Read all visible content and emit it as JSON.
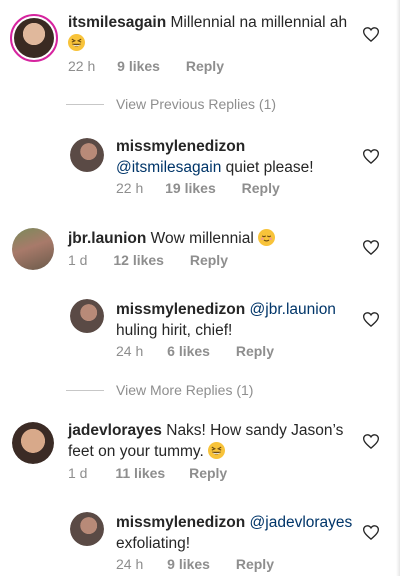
{
  "comments": [
    {
      "username": "itsmilesagain",
      "text": " Millennial na millennial ah ",
      "emoji": "grinning-squinting-face-emoji",
      "time": "22 h",
      "likes": "9 likes",
      "reply": "Reply"
    },
    {
      "username": "missmylenedizon",
      "mention": "@itsmilesagain",
      "text": " quiet please!",
      "time": "22 h",
      "likes": "19 likes",
      "reply": "Reply"
    },
    {
      "username": "jbr.launion",
      "text": " Wow millennial ",
      "emoji": "relieved-face-emoji",
      "time": "1 d",
      "likes": "12 likes",
      "reply": "Reply"
    },
    {
      "username": "missmylenedizon",
      "mention": "@jbr.launion",
      "text": "huling hirit, chief!",
      "time": "24 h",
      "likes": "6 likes",
      "reply": "Reply"
    },
    {
      "username": "jadevlorayes",
      "text": " Naks! How sandy Jason’s",
      "text2": "feet on your tummy. ",
      "emoji": "grinning-squinting-face-emoji",
      "time": "1 d",
      "likes": "11 likes",
      "reply": "Reply"
    },
    {
      "username": "missmylenedizon",
      "mention": "@jadevlorayes",
      "text": "exfoliating!",
      "time": "24 h",
      "likes": "9 likes",
      "reply": "Reply"
    }
  ],
  "view_previous_replies": "View Previous Replies (1)",
  "view_more_replies": "View More Replies (1)",
  "colors": {
    "text": "#262626",
    "meta": "#8e8e8e",
    "mention": "#003569",
    "story_ring": "#d6249f"
  }
}
